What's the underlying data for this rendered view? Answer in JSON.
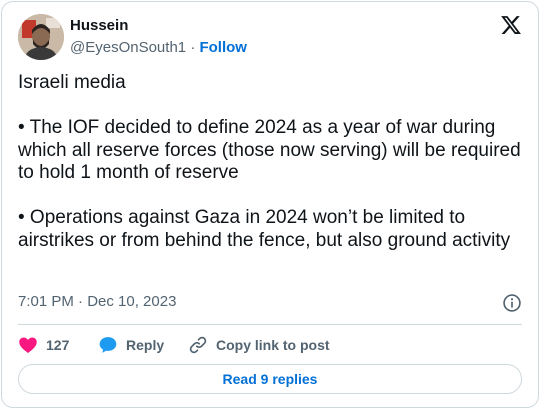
{
  "author": {
    "name": "Hussein",
    "handle": "@EyesOnSouth1",
    "separator": "·",
    "follow_label": "Follow"
  },
  "tweet": {
    "lines": [
      "Israeli media",
      "• The IOF decided to define 2024 as a year of war during which all reserve forces (those now serving) will be required to hold 1 month of reserve",
      "• Operations against Gaza in 2024 won’t be limited to airstrikes or from behind the fence, but also ground activity"
    ],
    "timestamp": "7:01 PM · Dec 10, 2023"
  },
  "actions": {
    "like_count": "127",
    "reply_label": "Reply",
    "copy_label": "Copy link to post"
  },
  "read_replies_label": "Read 9 replies",
  "icons": {
    "logo": "x-logo-icon",
    "like": "heart-icon",
    "reply": "speech-bubble-icon",
    "copy": "link-icon",
    "info": "info-icon"
  },
  "colors": {
    "like": "#f91880",
    "reply": "#1d9bf0",
    "link": "#006fd6",
    "muted": "#536471",
    "border": "#cfd9de"
  }
}
